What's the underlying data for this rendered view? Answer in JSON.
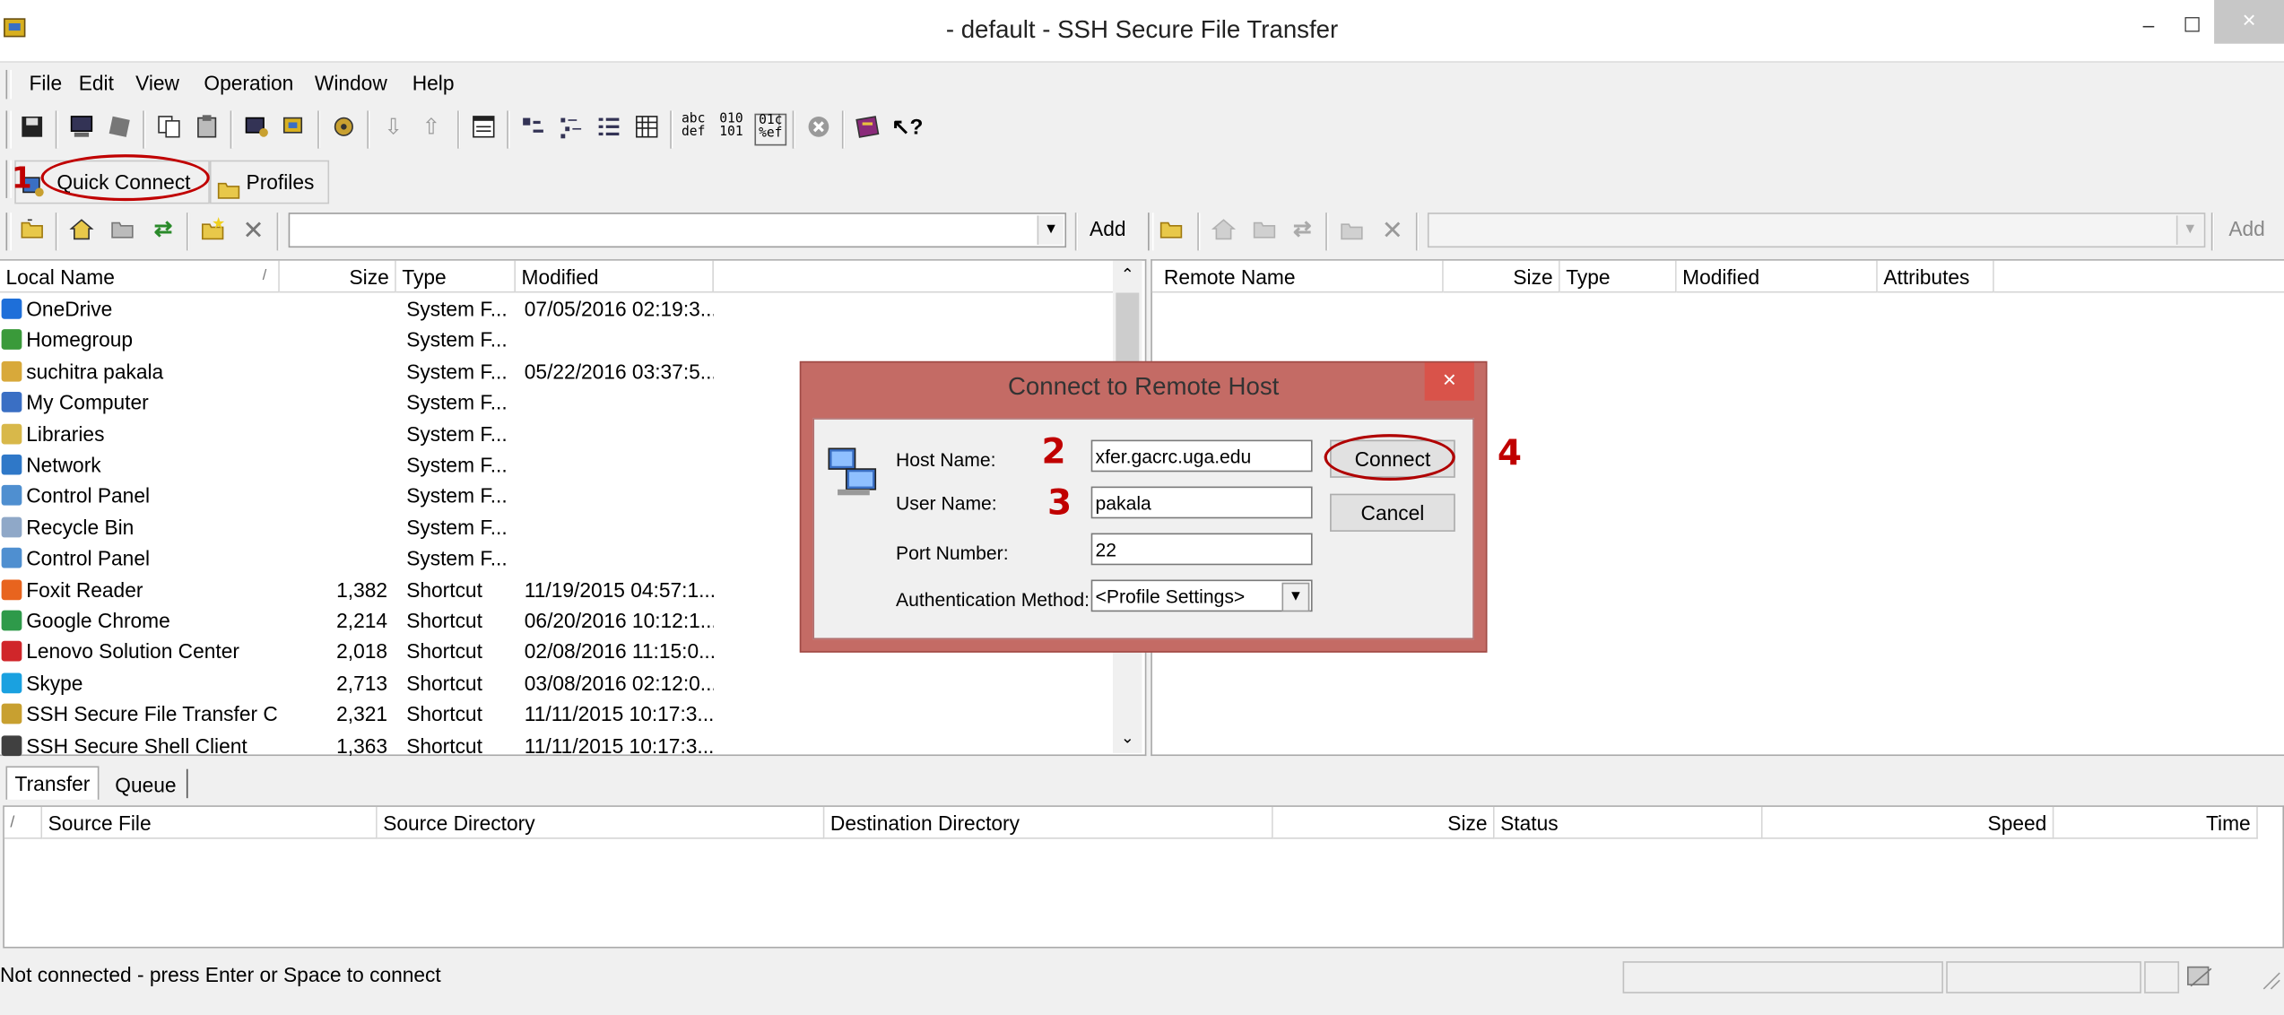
{
  "window": {
    "title": "- default - SSH Secure File Transfer",
    "min_glyph": "‒",
    "max_glyph": "☐",
    "close_glyph": "×"
  },
  "menu": [
    "File",
    "Edit",
    "View",
    "Operation",
    "Window",
    "Help"
  ],
  "quickbar": {
    "quick_connect": "Quick Connect",
    "profiles": "Profiles",
    "annotation": "1"
  },
  "nav": {
    "local_add": "Add",
    "remote_add": "Add"
  },
  "local": {
    "columns": [
      "Local Name",
      "/",
      "Size",
      "Type",
      "Modified"
    ],
    "rows": [
      {
        "name": "OneDrive",
        "size": "",
        "type": "System F...",
        "modified": "07/05/2016 02:19:3...",
        "icon": "cloud-icon",
        "color": "#1e6fd9"
      },
      {
        "name": "Homegroup",
        "size": "",
        "type": "System F...",
        "modified": "",
        "icon": "homegroup-icon",
        "color": "#3a9a3a"
      },
      {
        "name": "suchitra pakala",
        "size": "",
        "type": "System F...",
        "modified": "05/22/2016 03:37:5...",
        "icon": "user-folder-icon",
        "color": "#d8a93a"
      },
      {
        "name": "My Computer",
        "size": "",
        "type": "System F...",
        "modified": "",
        "icon": "computer-icon",
        "color": "#3a6fc4"
      },
      {
        "name": "Libraries",
        "size": "",
        "type": "System F...",
        "modified": "",
        "icon": "libraries-icon",
        "color": "#d8b84a"
      },
      {
        "name": "Network",
        "size": "",
        "type": "System F...",
        "modified": "",
        "icon": "network-icon",
        "color": "#2f78c8"
      },
      {
        "name": "Control Panel",
        "size": "",
        "type": "System F...",
        "modified": "",
        "icon": "control-panel-icon",
        "color": "#4f8fd0"
      },
      {
        "name": "Recycle Bin",
        "size": "",
        "type": "System F...",
        "modified": "",
        "icon": "recycle-bin-icon",
        "color": "#8fa8c8"
      },
      {
        "name": "Control Panel",
        "size": "",
        "type": "System F...",
        "modified": "",
        "icon": "control-panel-icon",
        "color": "#4f8fd0"
      },
      {
        "name": "Foxit Reader",
        "size": "1,382",
        "type": "Shortcut",
        "modified": "11/19/2015 04:57:1...",
        "icon": "foxit-icon",
        "color": "#e8641e"
      },
      {
        "name": "Google Chrome",
        "size": "2,214",
        "type": "Shortcut",
        "modified": "06/20/2016 10:12:1...",
        "icon": "chrome-icon",
        "color": "#2e9a4a"
      },
      {
        "name": "Lenovo Solution Center",
        "size": "2,018",
        "type": "Shortcut",
        "modified": "02/08/2016 11:15:0...",
        "icon": "lenovo-icon",
        "color": "#d0262a"
      },
      {
        "name": "Skype",
        "size": "2,713",
        "type": "Shortcut",
        "modified": "03/08/2016 02:12:0...",
        "icon": "skype-icon",
        "color": "#1aa1e0"
      },
      {
        "name": "SSH Secure File Transfer C...",
        "size": "2,321",
        "type": "Shortcut",
        "modified": "11/11/2015 10:17:3...",
        "icon": "ssh-ft-icon",
        "color": "#c8a030"
      },
      {
        "name": "SSH Secure Shell Client",
        "size": "1,363",
        "type": "Shortcut",
        "modified": "11/11/2015 10:17:3...",
        "icon": "ssh-shell-icon",
        "color": "#404040"
      }
    ]
  },
  "remote": {
    "columns": [
      "Remote Name",
      "Size",
      "Type",
      "Modified",
      "Attributes"
    ]
  },
  "dialog": {
    "title": "Connect to Remote Host",
    "close_glyph": "×",
    "host_label": "Host Name:",
    "host_value": "xfer.gacrc.uga.edu",
    "user_label": "User Name:",
    "user_value": "pakala",
    "port_label": "Port Number:",
    "port_value": "22",
    "auth_label": "Authentication Method:",
    "auth_value": "<Profile Settings>",
    "connect": "Connect",
    "cancel": "Cancel",
    "annotations": [
      "2",
      "3",
      "4"
    ]
  },
  "transfer": {
    "tabs": [
      "Transfer",
      "Queue"
    ],
    "columns": [
      "/",
      "Source File",
      "Source Directory",
      "Destination Directory",
      "Size",
      "Status",
      "Speed",
      "Time"
    ]
  },
  "status": {
    "text": "Not connected - press Enter or Space to connect"
  }
}
